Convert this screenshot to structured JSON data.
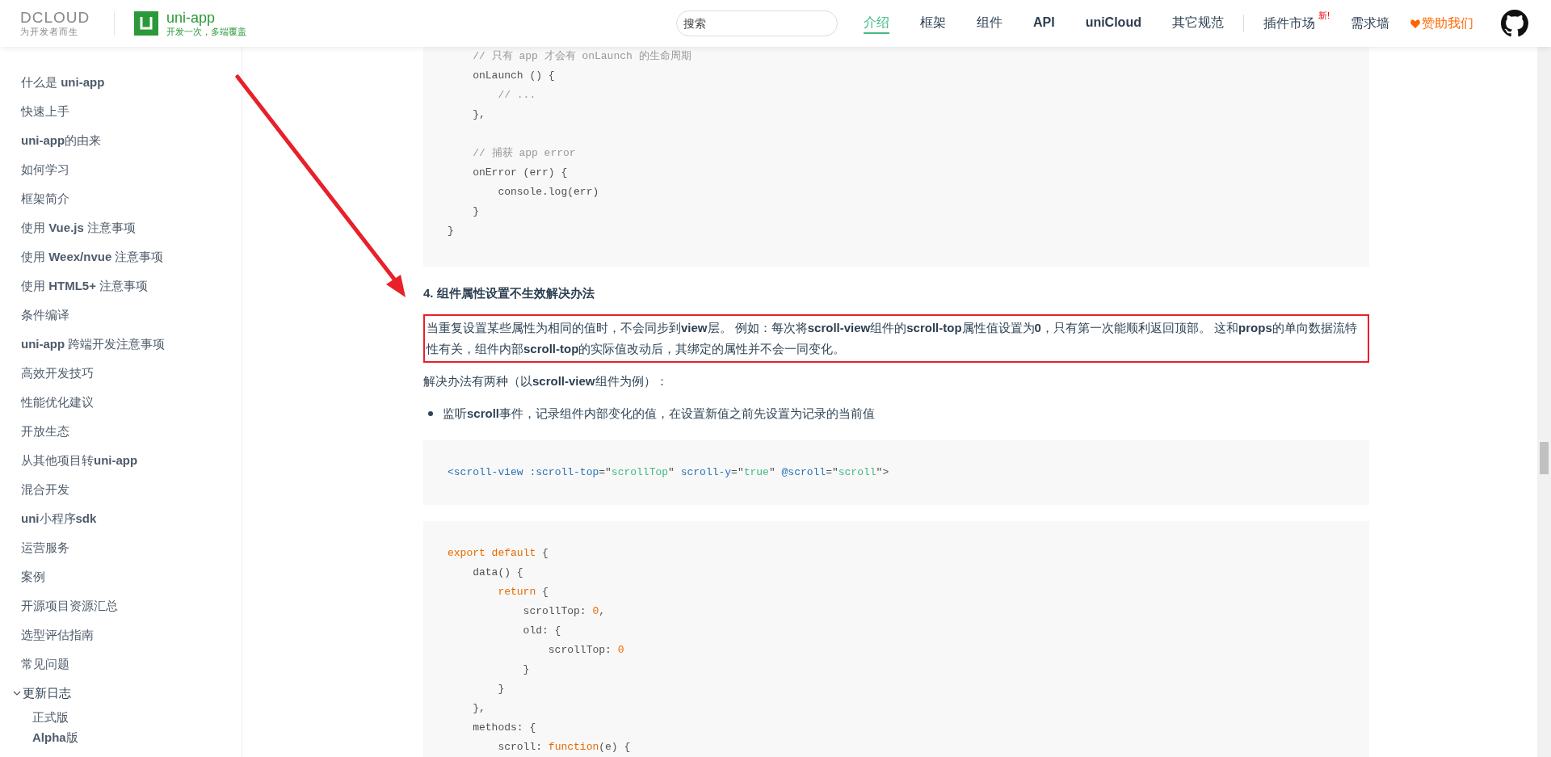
{
  "header": {
    "brand": {
      "company": "DCLOUD",
      "company_slogan": "为开发者而生",
      "product": "uni-app",
      "product_slogan": "开发一次，多端覆盖"
    },
    "search": {
      "placeholder": "搜索"
    },
    "nav": [
      {
        "label": "介绍",
        "selected": true,
        "kind": "plain"
      },
      {
        "label": "框架",
        "selected": false,
        "kind": "plain"
      },
      {
        "label": "组件",
        "selected": false,
        "kind": "plain"
      },
      {
        "label": "API",
        "selected": false,
        "kind": "bold"
      },
      {
        "label": "uniCloud",
        "selected": false,
        "kind": "bold"
      },
      {
        "label": "其它规范",
        "selected": false,
        "kind": "plain"
      }
    ],
    "extra_nav": [
      {
        "label": "插件市场",
        "badge": "新!",
        "kind": "plain"
      },
      {
        "label": "需求墙",
        "kind": "plain"
      },
      {
        "label": "赞助我们",
        "kind": "sponsor"
      },
      {
        "kind": "github"
      }
    ]
  },
  "sidebar": {
    "items": [
      {
        "label": "什么是 **uni-app**",
        "selected": false
      },
      {
        "label": "快速上手",
        "selected": false
      },
      {
        "label": "**uni-app**的由来",
        "selected": false
      },
      {
        "label": "如何学习",
        "selected": false
      },
      {
        "label": "框架简介",
        "selected": false
      },
      {
        "label": "使用 **Vue.js** 注意事项",
        "selected": false
      },
      {
        "label": "使用 **Weex/nvue** 注意事项",
        "selected": false
      },
      {
        "label": "使用 **HTML5+** 注意事项",
        "selected": false
      },
      {
        "label": "条件编译",
        "selected": false
      },
      {
        "label": "**uni-app** 跨端开发注意事项",
        "selected": false
      },
      {
        "label": "高效开发技巧",
        "selected": false
      },
      {
        "label": "性能优化建议",
        "selected": false
      },
      {
        "label": "开放生态",
        "selected": false
      },
      {
        "label": "从其他项目转**uni-app**",
        "selected": false
      },
      {
        "label": "混合开发",
        "selected": false
      },
      {
        "label": "**uni**小程序**sdk**",
        "selected": false
      },
      {
        "label": "运营服务",
        "selected": false
      },
      {
        "label": "案例",
        "selected": false
      },
      {
        "label": "开源项目资源汇总",
        "selected": false
      },
      {
        "label": "选型评估指南",
        "selected": false
      },
      {
        "label": "常见问题",
        "selected": false
      },
      {
        "label": "更新日志",
        "selected": false,
        "expanded": true,
        "children": [
          {
            "label": "正式版",
            "selected": false
          },
          {
            "label": "**Alpha**版",
            "selected": false
          }
        ]
      }
    ]
  },
  "content": {
    "blocks": [
      {
        "kind": "code",
        "lines": [
          {
            "kind": "code",
            "tokens": [
              {
                "kind": "comment",
                "text": "    // 只有 app 才会有 onLaunch 的生命周期"
              }
            ]
          },
          {
            "kind": "code",
            "tokens": [
              {
                "kind": "plain",
                "text": "    onLaunch () {"
              }
            ]
          },
          {
            "kind": "code",
            "tokens": [
              {
                "kind": "comment",
                "text": "        // ..."
              }
            ]
          },
          {
            "kind": "code",
            "tokens": [
              {
                "kind": "plain",
                "text": "    },"
              }
            ]
          },
          {
            "kind": "blank"
          },
          {
            "kind": "code",
            "tokens": [
              {
                "kind": "comment",
                "text": "    // 捕获 app error"
              }
            ]
          },
          {
            "kind": "code",
            "tokens": [
              {
                "kind": "plain",
                "text": "    onError (err) {"
              }
            ]
          },
          {
            "kind": "code",
            "tokens": [
              {
                "kind": "plain",
                "text": "        console.log(err)"
              }
            ]
          },
          {
            "kind": "code",
            "tokens": [
              {
                "kind": "plain",
                "text": "    }"
              }
            ]
          },
          {
            "kind": "code",
            "tokens": [
              {
                "kind": "plain",
                "text": "}"
              }
            ]
          }
        ]
      },
      {
        "kind": "heading",
        "text": "4. 组件属性设置不生效解决办法"
      },
      {
        "kind": "paragraph",
        "highlighted": true,
        "text": "当重复设置某些属性为相同的值时，不会同步到**view**层。 例如：每次将**scroll-view**组件的**scroll-top**属性值设置为**0**，只有第一次能顺利返回顶部。 这和**props**的单向数据流特性有关，组件内部**scroll-top**的实际值改动后，其绑定的属性并不会一同变化。"
      },
      {
        "kind": "paragraph",
        "highlighted": false,
        "text": "解决办法有两种（以**scroll-view**组件为例）："
      },
      {
        "kind": "bullet",
        "text": "监听**scroll**事件，记录组件内部变化的值，在设置新值之前先设置为记录的当前值"
      },
      {
        "kind": "code",
        "lines": [
          {
            "kind": "code",
            "tokens": [
              {
                "kind": "tag",
                "text": "<scroll-view"
              },
              {
                "kind": "attr",
                "text": " :scroll-top"
              },
              {
                "kind": "plain",
                "text": "=\""
              },
              {
                "kind": "string",
                "text": "scrollTop"
              },
              {
                "kind": "plain",
                "text": "\" "
              },
              {
                "kind": "attr",
                "text": "scroll-y"
              },
              {
                "kind": "plain",
                "text": "=\""
              },
              {
                "kind": "string",
                "text": "true"
              },
              {
                "kind": "plain",
                "text": "\" "
              },
              {
                "kind": "attr",
                "text": "@scroll"
              },
              {
                "kind": "plain",
                "text": "=\""
              },
              {
                "kind": "string",
                "text": "scroll"
              },
              {
                "kind": "plain",
                "text": "\">"
              }
            ]
          }
        ]
      },
      {
        "kind": "code",
        "lines": [
          {
            "kind": "code",
            "tokens": [
              {
                "kind": "keyword",
                "text": "export default"
              },
              {
                "kind": "plain",
                "text": " {"
              }
            ]
          },
          {
            "kind": "code",
            "tokens": [
              {
                "kind": "plain",
                "text": "    data() {"
              }
            ]
          },
          {
            "kind": "code",
            "tokens": [
              {
                "kind": "keyword",
                "text": "        return"
              },
              {
                "kind": "plain",
                "text": " {"
              }
            ]
          },
          {
            "kind": "code",
            "tokens": [
              {
                "kind": "plain",
                "text": "            scrollTop: "
              },
              {
                "kind": "number",
                "text": "0"
              },
              {
                "kind": "plain",
                "text": ","
              }
            ]
          },
          {
            "kind": "code",
            "tokens": [
              {
                "kind": "plain",
                "text": "            old: {"
              }
            ]
          },
          {
            "kind": "code",
            "tokens": [
              {
                "kind": "plain",
                "text": "                scrollTop: "
              },
              {
                "kind": "number",
                "text": "0"
              }
            ]
          },
          {
            "kind": "code",
            "tokens": [
              {
                "kind": "plain",
                "text": "            }"
              }
            ]
          },
          {
            "kind": "code",
            "tokens": [
              {
                "kind": "plain",
                "text": "        }"
              }
            ]
          },
          {
            "kind": "code",
            "tokens": [
              {
                "kind": "plain",
                "text": "    },"
              }
            ]
          },
          {
            "kind": "code",
            "tokens": [
              {
                "kind": "plain",
                "text": "    methods: {"
              }
            ]
          },
          {
            "kind": "code",
            "tokens": [
              {
                "kind": "plain",
                "text": "        scroll: "
              },
              {
                "kind": "keyword",
                "text": "function"
              },
              {
                "kind": "plain",
                "text": "(e) {"
              }
            ]
          }
        ]
      }
    ]
  }
}
